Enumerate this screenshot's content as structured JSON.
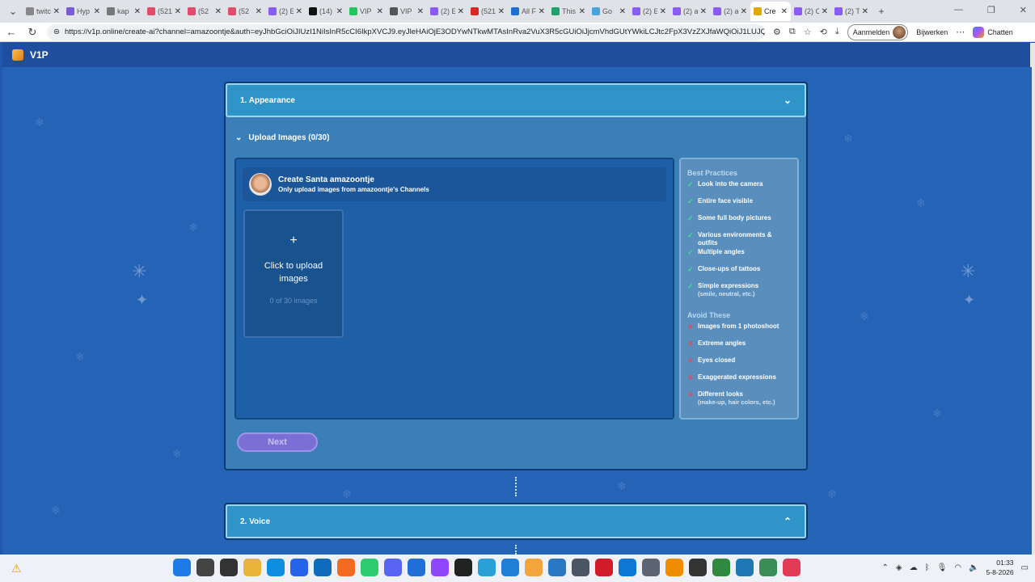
{
  "browser": {
    "tabs": [
      {
        "label": "twitc",
        "color": "#888"
      },
      {
        "label": "Hyp",
        "color": "#7b5cd6"
      },
      {
        "label": "kap",
        "color": "#777"
      },
      {
        "label": "(521",
        "color": "#e14c6a"
      },
      {
        "label": "(52",
        "color": "#e14c6a"
      },
      {
        "label": "(52",
        "color": "#e14c6a"
      },
      {
        "label": "(2) E",
        "color": "#8a5cf6"
      },
      {
        "label": "(14)",
        "color": "#111"
      },
      {
        "label": "VIP",
        "color": "#22c55e"
      },
      {
        "label": "VIP",
        "color": "#555"
      },
      {
        "label": "(2) E",
        "color": "#8a5cf6"
      },
      {
        "label": "(521",
        "color": "#dc2626"
      },
      {
        "label": "All F",
        "color": "#1d6fd1"
      },
      {
        "label": "This",
        "color": "#22a06b"
      },
      {
        "label": "Go",
        "color": "#4aa3df"
      },
      {
        "label": "(2) E",
        "color": "#8a5cf6"
      },
      {
        "label": "(2) a",
        "color": "#8a5cf6"
      },
      {
        "label": "(2) a",
        "color": "#8a5cf6"
      },
      {
        "label": "Cre",
        "color": "#e0a800",
        "active": true
      },
      {
        "label": "(2) C",
        "color": "#8a5cf6"
      },
      {
        "label": "(2) T",
        "color": "#8a5cf6"
      }
    ],
    "url": "https://v1p.online/create-ai?channel=amazoontje&auth=eyJhbGciOiJIUzI1NiIsInR5cCI6IkpXVCJ9.eyJleHAiOjE3ODYwNTkwMTAsInRva2VuX3R5cGUiOiJjcmVhdGUtYWkiLCJtc2FpX3VzZXJfaWQiOiJ1LUJQcDlD...",
    "signin_label": "Aanmelden",
    "update_label": "Bijwerken",
    "chat_label": "Chatten"
  },
  "app": {
    "brand": "V1P"
  },
  "appearance": {
    "title": "1. Appearance",
    "upload_toggle": "Upload Images (0/30)",
    "creator_title": "Create Santa amazoontje",
    "creator_subtitle": "Only upload images from amazoontje's Channels",
    "dropzone_plus": "+",
    "dropzone_label": "Click to upload images",
    "dropzone_count": "0 of 30 images",
    "best_heading": "Best Practices",
    "best": [
      {
        "text": "Look into the camera"
      },
      {
        "text": "Entire face visible"
      },
      {
        "text": "Some full body pictures"
      },
      {
        "text": "Various environments & outfits"
      },
      {
        "text": "Multiple angles"
      },
      {
        "text": "Close-ups of tattoos"
      },
      {
        "text": "Simple expressions",
        "sub": "(smile, neutral, etc.)"
      }
    ],
    "avoid_heading": "Avoid These",
    "avoid": [
      {
        "text": "Images from 1 photoshoot"
      },
      {
        "text": "Extreme angles"
      },
      {
        "text": "Eyes closed"
      },
      {
        "text": "Exaggerated expressions"
      },
      {
        "text": "Different looks",
        "sub": "(make-up, hair colors, etc.)"
      }
    ],
    "next_label": "Next"
  },
  "voice": {
    "title": "2. Voice"
  },
  "taskbar": {
    "clock_time": "01:33",
    "clock_date": "5-8-2026",
    "icons": [
      {
        "name": "start",
        "color": "#1e7ae6"
      },
      {
        "name": "search",
        "color": "#444"
      },
      {
        "name": "task-view",
        "color": "#333"
      },
      {
        "name": "file-explorer",
        "color": "#e8b53a"
      },
      {
        "name": "edge",
        "color": "#0e8ee0"
      },
      {
        "name": "store",
        "color": "#2563eb"
      },
      {
        "name": "outlook",
        "color": "#0f6cbd"
      },
      {
        "name": "firefox",
        "color": "#f36b20"
      },
      {
        "name": "whatsapp",
        "color": "#2ecc71"
      },
      {
        "name": "discord",
        "color": "#5865f2"
      },
      {
        "name": "app-blue",
        "color": "#1f6fd6"
      },
      {
        "name": "twitch",
        "color": "#9146ff"
      },
      {
        "name": "terminal",
        "color": "#222"
      },
      {
        "name": "photos",
        "color": "#2aa0d8"
      },
      {
        "name": "app-design",
        "color": "#1d80d6"
      },
      {
        "name": "app-images",
        "color": "#f3a43a"
      },
      {
        "name": "app-photo",
        "color": "#2b78c2"
      },
      {
        "name": "calculator",
        "color": "#4b5563"
      },
      {
        "name": "opera",
        "color": "#d11b2b"
      },
      {
        "name": "vscode",
        "color": "#0a78d4"
      },
      {
        "name": "settings",
        "color": "#5b6470"
      },
      {
        "name": "vlc",
        "color": "#f08c00"
      },
      {
        "name": "app-dark",
        "color": "#333"
      },
      {
        "name": "chrome",
        "color": "#2f8a3f"
      },
      {
        "name": "app-camera",
        "color": "#1f77b4"
      },
      {
        "name": "app-green",
        "color": "#3b8d55"
      },
      {
        "name": "music",
        "color": "#e23a57"
      }
    ]
  },
  "colors": {
    "background": "#2563b7",
    "panel_header": "#2f95c8",
    "next_button": "#7b6fd6",
    "check": "#3ee08a",
    "cross": "#e04a5a"
  }
}
